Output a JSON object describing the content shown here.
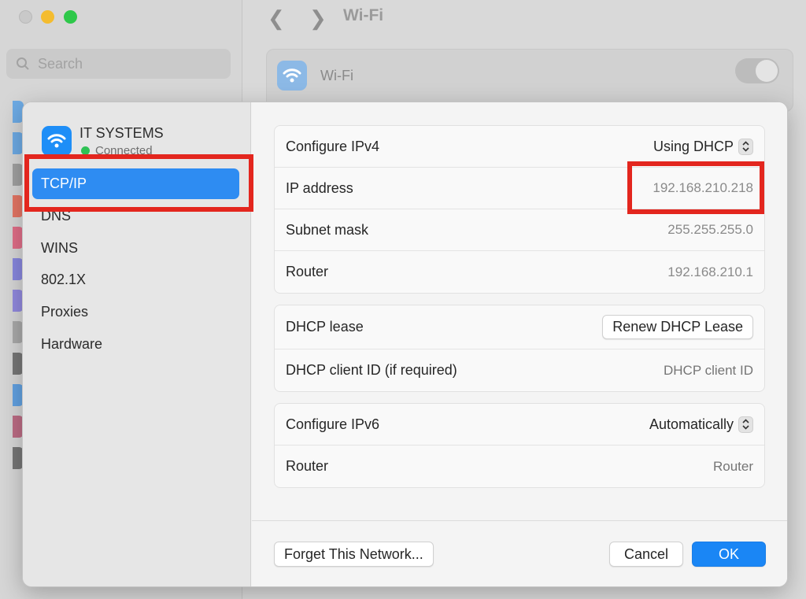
{
  "window": {
    "title": "Wi-Fi",
    "search_placeholder": "Search",
    "wifi_label": "Wi-Fi"
  },
  "network": {
    "name": "IT SYSTEMS",
    "status": "Connected"
  },
  "sidebar": {
    "items": [
      {
        "label": "TCP/IP",
        "active": true
      },
      {
        "label": "DNS"
      },
      {
        "label": "WINS"
      },
      {
        "label": "802.1X"
      },
      {
        "label": "Proxies"
      },
      {
        "label": "Hardware"
      }
    ]
  },
  "ipv4": {
    "configure_label": "Configure IPv4",
    "configure_value": "Using DHCP",
    "ip_label": "IP address",
    "ip_value": "192.168.210.218",
    "subnet_label": "Subnet mask",
    "subnet_value": "255.255.255.0",
    "router_label": "Router",
    "router_value": "192.168.210.1"
  },
  "dhcp": {
    "lease_label": "DHCP lease",
    "renew_button": "Renew DHCP Lease",
    "client_id_label": "DHCP client ID (if required)",
    "client_id_placeholder": "DHCP client ID"
  },
  "ipv6": {
    "configure_label": "Configure IPv6",
    "configure_value": "Automatically",
    "router_label": "Router",
    "router_placeholder": "Router"
  },
  "footer": {
    "forget_button": "Forget This Network...",
    "cancel_button": "Cancel",
    "ok_button": "OK"
  },
  "colors": {
    "accent": "#2e8cf2",
    "highlight": "#e3261e",
    "connected": "#2fc255"
  }
}
